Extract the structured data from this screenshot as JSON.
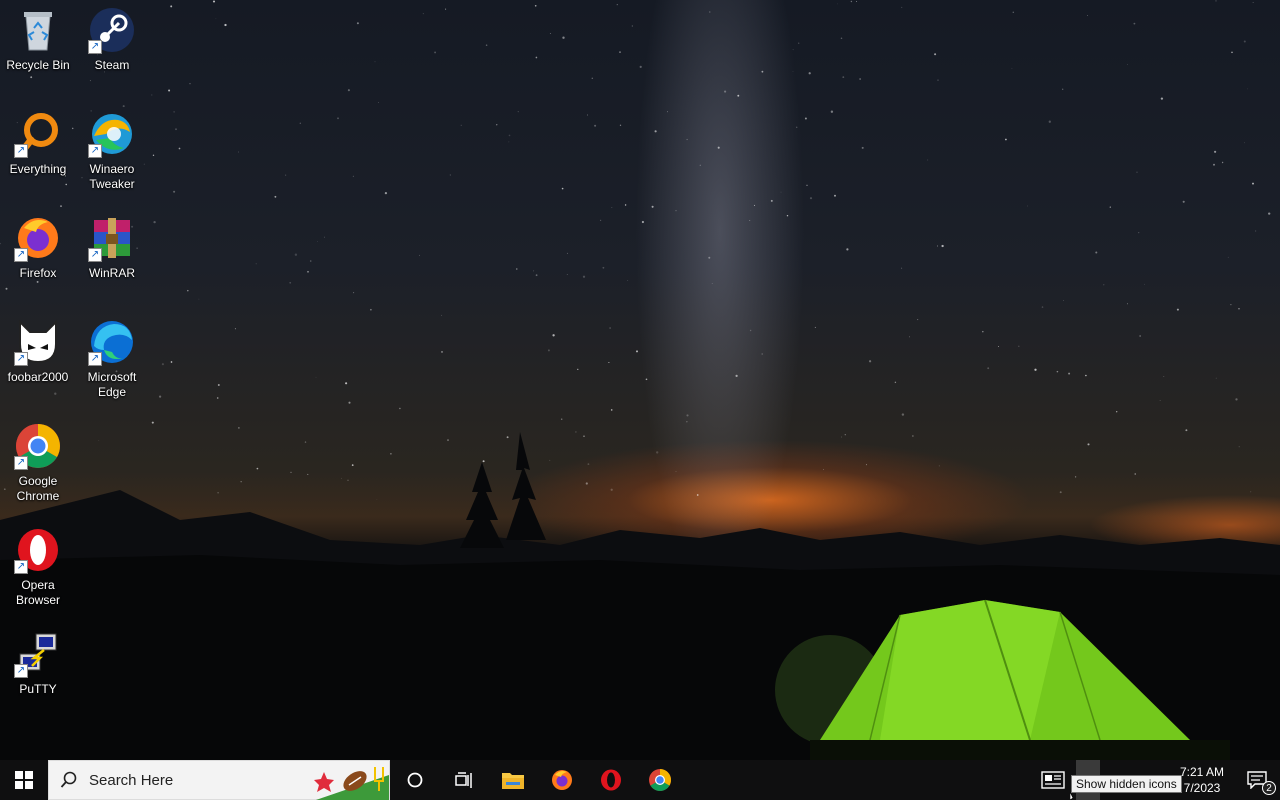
{
  "desktop_icons": [
    {
      "label": "Recycle Bin",
      "icon": "recycle-bin-icon"
    },
    {
      "label": "Steam",
      "icon": "steam-icon"
    },
    {
      "label": "Everything",
      "icon": "everything-icon"
    },
    {
      "label": "Winaero Tweaker",
      "icon": "winaero-tweaker-icon"
    },
    {
      "label": "Firefox",
      "icon": "firefox-icon"
    },
    {
      "label": "WinRAR",
      "icon": "winrar-icon"
    },
    {
      "label": "foobar2000",
      "icon": "foobar2000-icon"
    },
    {
      "label": "Microsoft Edge",
      "icon": "edge-icon"
    },
    {
      "label": "Google Chrome",
      "icon": "chrome-icon"
    },
    {
      "label": "Opera Browser",
      "icon": "opera-icon"
    },
    {
      "label": "PuTTY",
      "icon": "putty-icon"
    }
  ],
  "taskbar": {
    "search_placeholder": "Search Here",
    "pinned": [
      "file-explorer-icon",
      "firefox-icon",
      "opera-icon",
      "chrome-icon"
    ]
  },
  "tray": {
    "time": "7:21 AM",
    "date": "7/2023",
    "notification_count": "2",
    "tooltip": "Show hidden icons"
  },
  "colors": {
    "taskbar": "#0f0f10",
    "search_bg": "#f3f3f3",
    "tent": "#7bd21e"
  }
}
